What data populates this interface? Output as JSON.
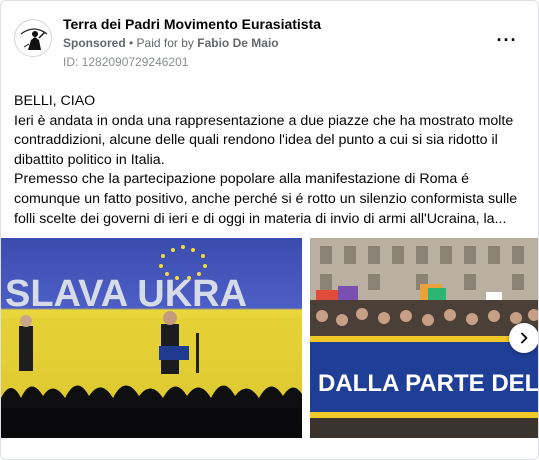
{
  "post": {
    "page_name": "Terra dei Padri Movimento Eurasiatista",
    "sponsored_label": "Sponsored",
    "separator": " • ",
    "paid_for_by": "Paid for by",
    "sponsor_name": "Fabio De Maio",
    "ad_id": "ID: 1282090729246201",
    "more_icon": "more-horizontal-icon",
    "text_lines": [
      "BELLI, CIAO",
      "Ieri è andata in onda una rappresentazione a due piazze che ha mostrato molte contraddizioni, alcune delle quali rendono l'idea del punto a cui si sia ridotto il dibattito politico in Italia.",
      "Premesso che la partecipazione popolare alla manifestazione di Roma é comunque un fatto positivo, anche perché si é rotto un silenzio conformista sulle folli scelte dei governi di ieri e di oggi in materia di invio di armi all'Ucraina, la..."
    ],
    "images": [
      {
        "banner_text": "SLAVA UKRA"
      },
      {
        "banner_text": "DALLA PARTE DELLA"
      }
    ],
    "next_icon": "chevron-right-icon"
  }
}
